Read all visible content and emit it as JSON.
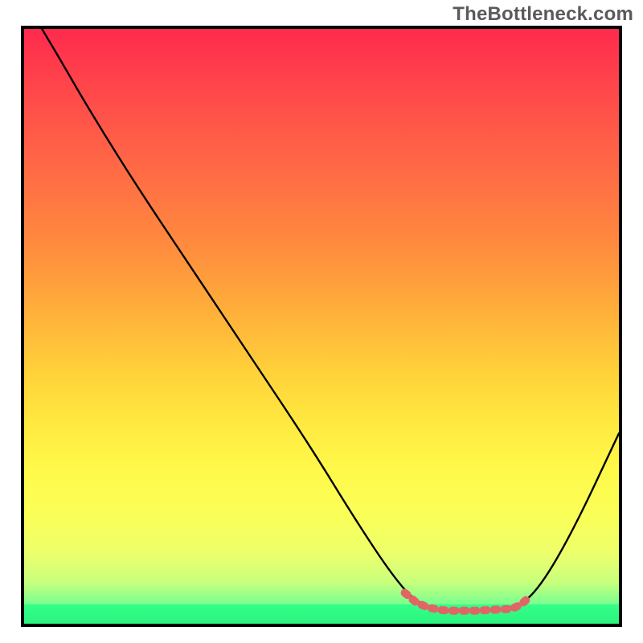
{
  "watermark": "TheBottleneck.com",
  "colors": {
    "gradient_top": "#ff2a4d",
    "gradient_mid": "#ffd23a",
    "gradient_bottom": "#2bf37f",
    "curve": "#000000",
    "marker": "#e06666",
    "border": "#000000"
  },
  "chart_data": {
    "type": "line",
    "title": "",
    "xlabel": "",
    "ylabel": "",
    "xlim": [
      0,
      100
    ],
    "ylim": [
      0,
      100
    ],
    "annotations": [
      "TheBottleneck.com"
    ],
    "curve_points": [
      {
        "x": 3,
        "y": 100
      },
      {
        "x": 6,
        "y": 95
      },
      {
        "x": 10,
        "y": 88
      },
      {
        "x": 18,
        "y": 75
      },
      {
        "x": 28,
        "y": 60
      },
      {
        "x": 38,
        "y": 45
      },
      {
        "x": 48,
        "y": 30
      },
      {
        "x": 56,
        "y": 17
      },
      {
        "x": 62,
        "y": 8
      },
      {
        "x": 66,
        "y": 3.5
      },
      {
        "x": 70,
        "y": 2.3
      },
      {
        "x": 76,
        "y": 2.2
      },
      {
        "x": 82,
        "y": 2.5
      },
      {
        "x": 86,
        "y": 5
      },
      {
        "x": 92,
        "y": 15
      },
      {
        "x": 100,
        "y": 32
      }
    ],
    "marker_segment": [
      {
        "x": 64,
        "y": 5.2
      },
      {
        "x": 66,
        "y": 3.5
      },
      {
        "x": 68,
        "y": 2.7
      },
      {
        "x": 70,
        "y": 2.3
      },
      {
        "x": 72,
        "y": 2.2
      },
      {
        "x": 74,
        "y": 2.2
      },
      {
        "x": 76,
        "y": 2.2
      },
      {
        "x": 78,
        "y": 2.3
      },
      {
        "x": 80,
        "y": 2.4
      },
      {
        "x": 82,
        "y": 2.5
      },
      {
        "x": 83.5,
        "y": 3.2
      },
      {
        "x": 85,
        "y": 4.5
      }
    ]
  }
}
